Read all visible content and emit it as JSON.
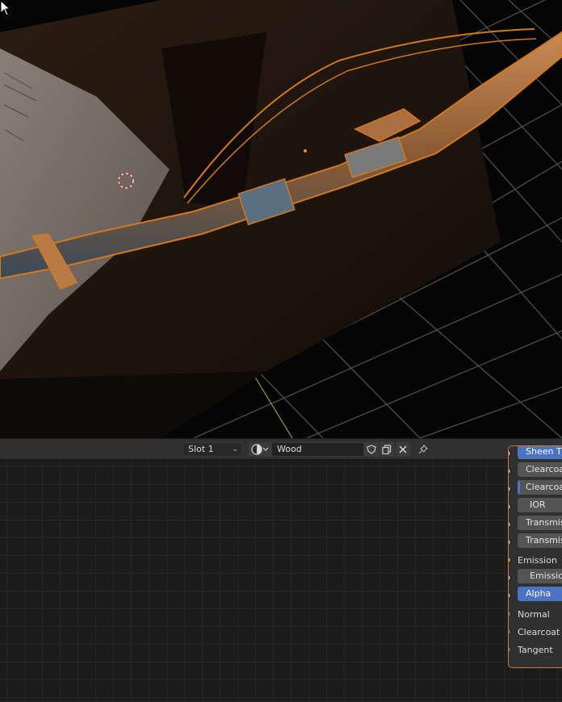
{
  "header": {
    "slot": "Slot 1",
    "material_name": "Wood"
  },
  "node": {
    "fields": [
      {
        "label": "Sheen Tint",
        "style": "selected"
      },
      {
        "label": "Clearcoat",
        "style": "normal"
      },
      {
        "label": "Clearcoat Roughness",
        "style": "partial"
      },
      {
        "label": "IOR",
        "style": "normal"
      },
      {
        "label": "Transmission",
        "style": "normal"
      },
      {
        "label": "Transmission Roughness",
        "style": "normal"
      },
      {
        "label": "Emission",
        "style": "label"
      },
      {
        "label": "Emission Strength",
        "style": "normal"
      },
      {
        "label": "Alpha",
        "style": "selected"
      },
      {
        "label": "Normal",
        "style": "label"
      },
      {
        "label": "Clearcoat Normal",
        "style": "label"
      },
      {
        "label": "Tangent",
        "style": "label"
      }
    ]
  },
  "colors": {
    "selection_outline": "#d2781e",
    "accent_blue": "#4b74c4"
  }
}
